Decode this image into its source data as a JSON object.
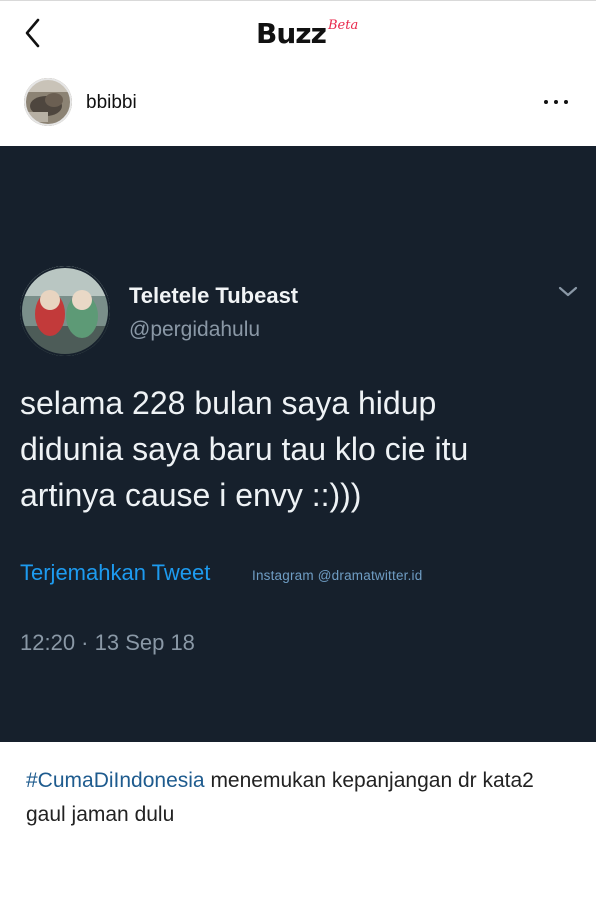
{
  "nav": {
    "back_icon": "chevron-left-icon",
    "brand": "Buzz",
    "brand_badge": "Beta",
    "brand_badge_color": "#e8274b"
  },
  "post": {
    "username": "bbibbi",
    "more_icon": "more-horizontal-icon"
  },
  "tweet": {
    "background": "#16202c",
    "display_name": "Teletele Tubeast",
    "handle": "@pergidahulu",
    "text_lines": [
      "selama 228 bulan saya hidup",
      "didunia saya baru tau klo cie itu",
      "artinya cause i envy ::)))"
    ],
    "translate_label": "Terjemahkan Tweet",
    "watermark": "Instagram @dramatwitter.id",
    "timestamp": "12:20 · 13 Sep 18",
    "link_color": "#1d9bf0"
  },
  "caption": {
    "hashtag": "#CumaDiIndonesia",
    "text": " menemukan kepanjangan dr kata2 gaul jaman dulu",
    "hashtag_color": "#1e5b8e"
  }
}
